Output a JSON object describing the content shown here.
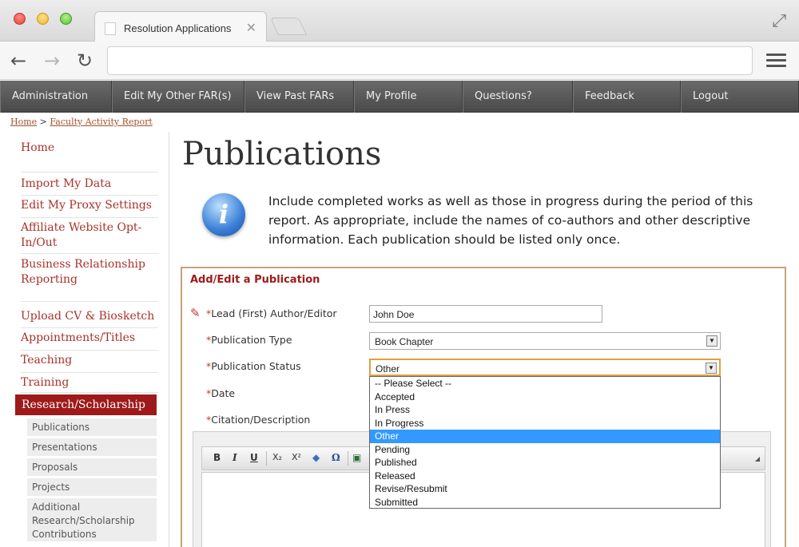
{
  "browser": {
    "tab_title": "Resolution Applications",
    "tab_close": "✕",
    "url": ""
  },
  "nav": {
    "items": [
      {
        "label": "Administration"
      },
      {
        "label": "Edit My Other FAR(s)"
      },
      {
        "label": "View Past FARs"
      },
      {
        "label": "My Profile"
      },
      {
        "label": "Questions?"
      },
      {
        "label": "Feedback"
      },
      {
        "label": "Logout"
      }
    ]
  },
  "breadcrumb": {
    "home": "Home",
    "separator": ">",
    "current": "Faculty Activity Report"
  },
  "sidebar": {
    "items": [
      {
        "label": "Home"
      },
      {
        "label": "Import My Data"
      },
      {
        "label": "Edit My Proxy Settings"
      },
      {
        "label": "Affiliate Website Opt-In/Out"
      },
      {
        "label": "Business Relationship Reporting"
      },
      {
        "label": "Upload CV & Biosketch"
      },
      {
        "label": "Appointments/Titles"
      },
      {
        "label": "Teaching"
      },
      {
        "label": "Training"
      }
    ],
    "active": "Research/Scholarship",
    "subitems": [
      {
        "label": "Publications"
      },
      {
        "label": "Presentations"
      },
      {
        "label": "Proposals"
      },
      {
        "label": "Projects"
      },
      {
        "label": "Additional Research/Scholarship Contributions"
      }
    ]
  },
  "main": {
    "title": "Publications",
    "info_text": "Include completed works as well as those in progress during the period of this report. As appropriate, include the names of co-authors and other descriptive information. Each publication should be listed only once."
  },
  "form": {
    "heading": "Add/Edit a Publication",
    "required_mark": "*",
    "labels": {
      "author": "Lead (First) Author/Editor",
      "type": "Publication Type",
      "status": "Publication Status",
      "date": "Date",
      "citation": "Citation/Description"
    },
    "author_value": "John Doe",
    "type_value": "Book Chapter",
    "status_value": "Other",
    "status_options": [
      "-- Please Select --",
      "Accepted",
      "In Press",
      "In Progress",
      "Other",
      "Pending",
      "Published",
      "Released",
      "Revise/Resubmit",
      "Submitted"
    ],
    "selected_index": 4
  },
  "editor": {
    "toolbar": {
      "bold": "B",
      "italic": "I",
      "underline": "U",
      "subscript": "X₂",
      "superscript": "X²",
      "special_char": "Ω"
    }
  },
  "colors": {
    "accent": "#9e1a1a",
    "link": "#a8322a",
    "form_border": "#c8a27a",
    "selected_option": "#3399ff"
  }
}
